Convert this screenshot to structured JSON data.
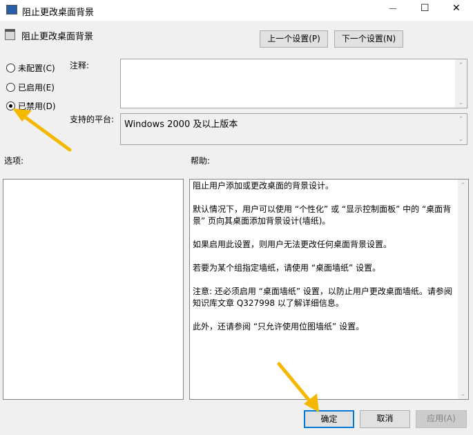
{
  "window": {
    "title": "阻止更改桌面背景",
    "minimize": "—",
    "maximize": "☐",
    "close": "✕"
  },
  "header": {
    "title": "阻止更改桌面背景",
    "prev_button": "上一个设置(P)",
    "next_button": "下一个设置(N)"
  },
  "radios": [
    {
      "label": "未配置(C)",
      "checked": false
    },
    {
      "label": "已启用(E)",
      "checked": false
    },
    {
      "label": "已禁用(D)",
      "checked": true
    }
  ],
  "comment": {
    "label": "注释:",
    "value": ""
  },
  "platform": {
    "label": "支持的平台:",
    "value": "Windows 2000 及以上版本"
  },
  "options": {
    "label": "选项:"
  },
  "help": {
    "label": "帮助:",
    "paragraphs": [
      "阻止用户添加或更改桌面的背景设计。",
      "默认情况下，用户可以使用 “个性化” 或 “显示控制面板” 中的 “桌面背景” 页向其桌面添加背景设计(墙纸)。",
      "如果启用此设置，则用户无法更改任何桌面背景设置。",
      "若要为某个组指定墙纸，请使用 “桌面墙纸” 设置。",
      "注意: 还必须启用 “桌面墙纸” 设置，以防止用户更改桌面墙纸。请参阅知识库文章 Q327998 以了解详细信息。",
      "此外，还请参阅 “只允许使用位图墙纸” 设置。"
    ]
  },
  "footer": {
    "ok": "确定",
    "cancel": "取消",
    "apply": "应用(A)"
  },
  "colors": {
    "accent": "#0078d7",
    "arrow": "#f5b800"
  }
}
